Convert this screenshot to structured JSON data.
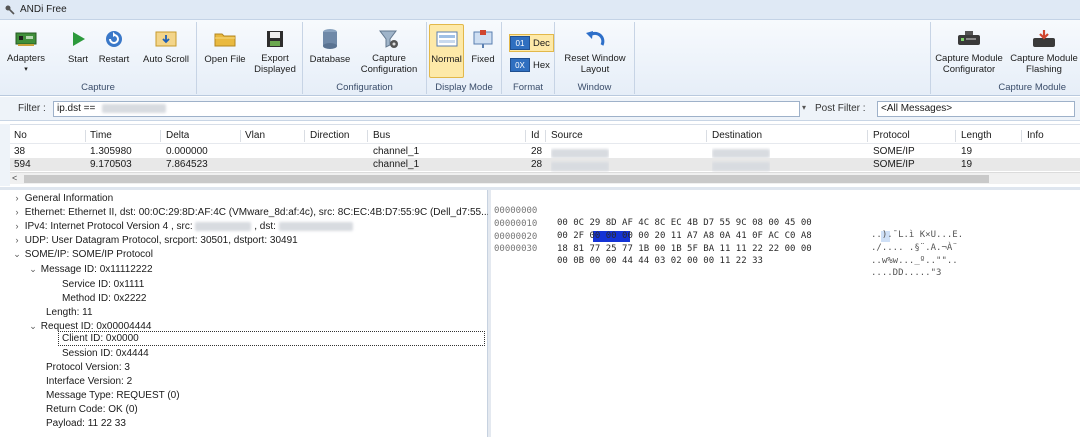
{
  "window": {
    "title": "ANDi Free"
  },
  "ribbon": {
    "capture": {
      "label": "Capture",
      "adapters": "Adapters",
      "start": "Start",
      "restart": "Restart",
      "auto_scroll": "Auto Scroll"
    },
    "file": {
      "open_file": "Open File",
      "export_line1": "Export",
      "export_line2": "Displayed"
    },
    "configuration": {
      "label": "Configuration",
      "database": "Database",
      "capture_config_line1": "Capture",
      "capture_config_line2": "Configuration"
    },
    "display_mode": {
      "label": "Display Mode",
      "normal": "Normal",
      "fixed": "Fixed"
    },
    "format": {
      "label": "Format",
      "dec_chip": "01",
      "dec": "Dec",
      "hex_chip": "0X",
      "hex": "Hex"
    },
    "window_group": {
      "label": "Window",
      "reset_line1": "Reset Window",
      "reset_line2": "Layout"
    },
    "capture_module": {
      "label": "Capture Module",
      "configurator_line1": "Capture Module",
      "configurator_line2": "Configurator",
      "flashing_line1": "Capture Module",
      "flashing_line2": "Flashing"
    }
  },
  "filter": {
    "label": "Filter :",
    "value": "ip.dst ==",
    "post_label": "Post Filter :",
    "post_value": "<All Messages>"
  },
  "packet_list": {
    "columns": [
      "No",
      "Time",
      "Delta",
      "Vlan",
      "Direction",
      "Bus",
      "Id",
      "Source",
      "Destination",
      "Protocol",
      "Length",
      "Info"
    ],
    "rows": [
      {
        "no": "38",
        "time": "1.305980",
        "delta": "0.000000",
        "bus": "channel_1",
        "id": "28",
        "protocol": "SOME/IP",
        "length": "19"
      },
      {
        "no": "594",
        "time": "9.170503",
        "delta": "7.864523",
        "bus": "channel_1",
        "id": "28",
        "protocol": "SOME/IP",
        "length": "19"
      }
    ],
    "scroll_left": "<"
  },
  "tree": {
    "general": "General Information",
    "ethernet": "Ethernet: Ethernet II, dst: 00:0C:29:8D:AF:4C (VMware_8d:af:4c), src: 8C:EC:4B:D7:55:9C (Dell_d7:55...",
    "ipv4_a": "IPv4: Internet Protocol Version 4 , src:",
    "ipv4_b": ", dst:",
    "udp": "UDP: User Datagram Protocol, srcport: 30501, dstport: 30491",
    "someip": "SOME/IP: SOME/IP Protocol",
    "message_id": "Message ID: 0x11112222",
    "service_id": "Service ID: 0x1111",
    "method_id": "Method ID: 0x2222",
    "length": "Length: 11",
    "request_id": "Request ID: 0x00004444",
    "client_id": "Client ID: 0x0000",
    "session_id": "Session ID: 0x4444",
    "protocol_version": "Protocol Version: 3",
    "interface_version": "Interface Version: 2",
    "message_type": "Message Type: REQUEST (0)",
    "return_code": "Return Code: OK (0)",
    "payload": "Payload: 11 22 33"
  },
  "hex": {
    "rows": [
      {
        "offset": "00000000",
        "bytes": "00 0C 29 8D AF 4C 8C EC 4B D7 55 9C 08 00 45 00",
        "ascii": "..).¯L.ì K×U...E."
      },
      {
        "offset": "00000010",
        "bytes": "00 2F 00 00 00 00 20 11 A7 A8 0A 41 0F AC C0 A8",
        "ascii": "./.... .§¨.A.¬À¨"
      },
      {
        "offset": "00000020",
        "bytes": "18 81 77 25 77 1B 00 1B 5F BA 11 11 22 22 00 00",
        "ascii": "..w%w..._º..\"\".."
      },
      {
        "offset": "00000030",
        "bytes": "00 0B 00 00 44 44 03 02 00 00 11 22 33",
        "ascii": "....DD.....\"3"
      }
    ]
  }
}
